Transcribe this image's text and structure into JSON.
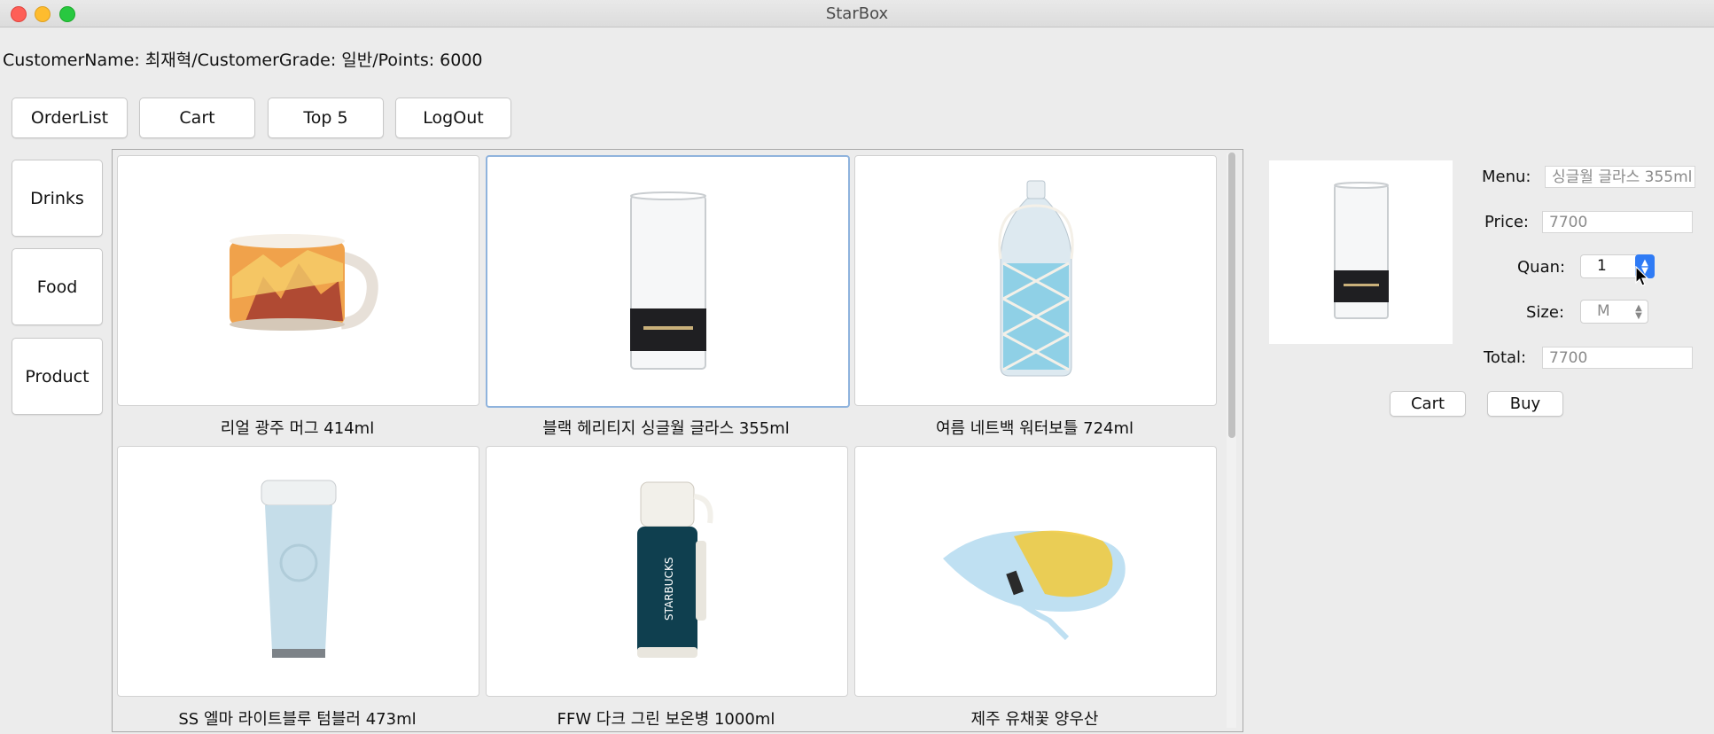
{
  "window": {
    "title": "StarBox"
  },
  "customer": {
    "info": "CustomerName: 최재혁/CustomerGrade: 일반/Points: 6000"
  },
  "top_buttons": [
    "OrderList",
    "Cart",
    "Top 5",
    "LogOut"
  ],
  "categories": [
    "Drinks",
    "Food",
    "Product"
  ],
  "products": [
    {
      "name": "리얼 광주 머그 414ml",
      "icon": "mug-icon"
    },
    {
      "name": "블랙 헤리티지 싱글월 글라스 355ml",
      "icon": "glass-icon",
      "selected": true
    },
    {
      "name": "여름 네트백 워터보틀 724ml",
      "icon": "water-bottle-icon"
    },
    {
      "name": "SS 엘마 라이트블루 텀블러 473ml",
      "icon": "tumbler-icon"
    },
    {
      "name": "FFW 다크 그린 보온병 1000ml",
      "icon": "thermos-icon"
    },
    {
      "name": "제주 유채꽃 양우산",
      "icon": "umbrella-icon"
    }
  ],
  "detail": {
    "menu_label": "Menu:",
    "menu_value": "싱글월 글라스 355ml",
    "price_label": "Price:",
    "price_value": "7700",
    "quan_label": "Quan:",
    "quan_value": "1",
    "size_label": "Size:",
    "size_value": "M",
    "total_label": "Total:",
    "total_value": "7700",
    "cart_label": "Cart",
    "buy_label": "Buy"
  },
  "colors": {
    "accent": "#2f7bf5",
    "selection_border": "#8fb3dd"
  }
}
